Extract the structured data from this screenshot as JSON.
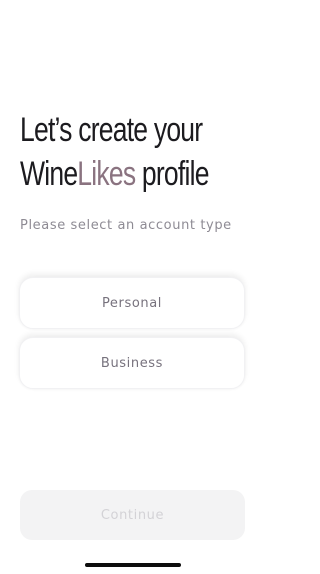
{
  "headline": {
    "line1": "Let’s create your",
    "brand_part1": "Wine",
    "brand_part2": "Likes",
    "line2_suffix": " profile"
  },
  "subtitle": "Please select an account type",
  "account_types": [
    {
      "label": "Personal"
    },
    {
      "label": "Business"
    }
  ],
  "continue_label": "Continue",
  "colors": {
    "headline": "#1c1b1f",
    "brand_accent": "#8a7380",
    "subtitle": "#8e8b94",
    "option_text": "#77727d",
    "continue_bg": "#f3f3f4",
    "continue_text_disabled": "#d3d2d6"
  }
}
